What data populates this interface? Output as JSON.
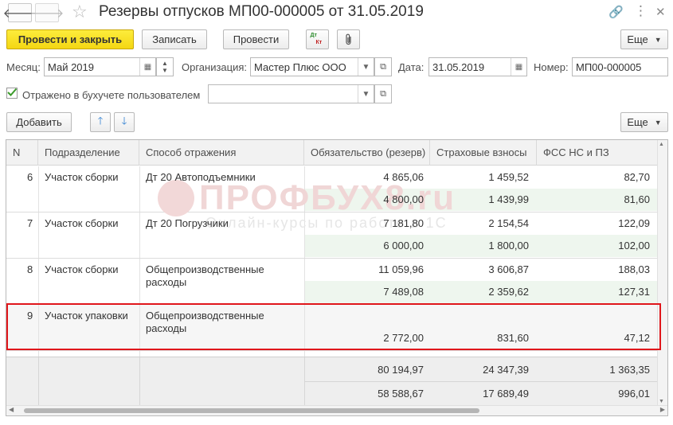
{
  "window": {
    "title": "Резервы отпусков МП00-000005 от 31.05.2019",
    "back_glyph": "🡐",
    "forward_glyph": "🡒",
    "link_glyph": "🔗",
    "menu_glyph": "⋮",
    "close_glyph": "✕"
  },
  "toolbar": {
    "post_close": "Провести и закрыть",
    "save": "Записать",
    "post": "Провести",
    "dtkt_top": "Дт",
    "dtkt_bottom": "Кт",
    "more": "Еще"
  },
  "form": {
    "month_label": "Месяц:",
    "month_value": "Май 2019",
    "org_label": "Организация:",
    "org_value": "Мастер Плюс ООО",
    "date_label": "Дата:",
    "date_value": "31.05.2019",
    "number_label": "Номер:",
    "number_value": "МП00-000005",
    "checkbox_label": "Отражено в бухучете пользователем",
    "user_value": ""
  },
  "table_toolbar": {
    "add": "Добавить",
    "more": "Еще"
  },
  "table": {
    "columns": [
      "N",
      "Подразделение",
      "Способ отражения",
      "Обязательство (резерв)",
      "Страховые взносы",
      "ФСС НС и ПЗ"
    ],
    "rows": [
      {
        "n": "6",
        "dept": "Участок сборки",
        "method": "Дт 20 Автоподъемники",
        "method2": "",
        "obl1": "4 865,06",
        "ins1": "1 459,52",
        "fss1": "82,70",
        "obl2": "4 800,00",
        "ins2": "1 439,99",
        "fss2": "81,60"
      },
      {
        "n": "7",
        "dept": "Участок сборки",
        "method": "Дт 20 Погрузчики",
        "method2": "",
        "obl1": "7 181,80",
        "ins1": "2 154,54",
        "fss1": "122,09",
        "obl2": "6 000,00",
        "ins2": "1 800,00",
        "fss2": "102,00"
      },
      {
        "n": "8",
        "dept": "Участок сборки",
        "method": "Общепроизводственные",
        "method2": "расходы",
        "obl1": "11 059,96",
        "ins1": "3 606,87",
        "fss1": "188,03",
        "obl2": "7 489,08",
        "ins2": "2 359,62",
        "fss2": "127,31"
      },
      {
        "n": "9",
        "dept": "Участок упаковки",
        "method": "Общепроизводственные",
        "method2": "расходы",
        "obl1": "",
        "ins1": "",
        "fss1": "",
        "obl2": "2 772,00",
        "ins2": "831,60",
        "fss2": "47,12"
      }
    ],
    "totals": {
      "obl1": "80 194,97",
      "ins1": "24 347,39",
      "fss1": "1 363,35",
      "obl2": "58 588,67",
      "ins2": "17 689,49",
      "fss2": "996,01"
    }
  },
  "watermark": {
    "brand": "ПРОФБУХ8.ru",
    "tagline": "Онлайн-курсы по работе в 1С"
  },
  "colors": {
    "primary_button": "#f4d713",
    "highlight_border": "#e0161b",
    "green_band": "#eef6ee"
  }
}
